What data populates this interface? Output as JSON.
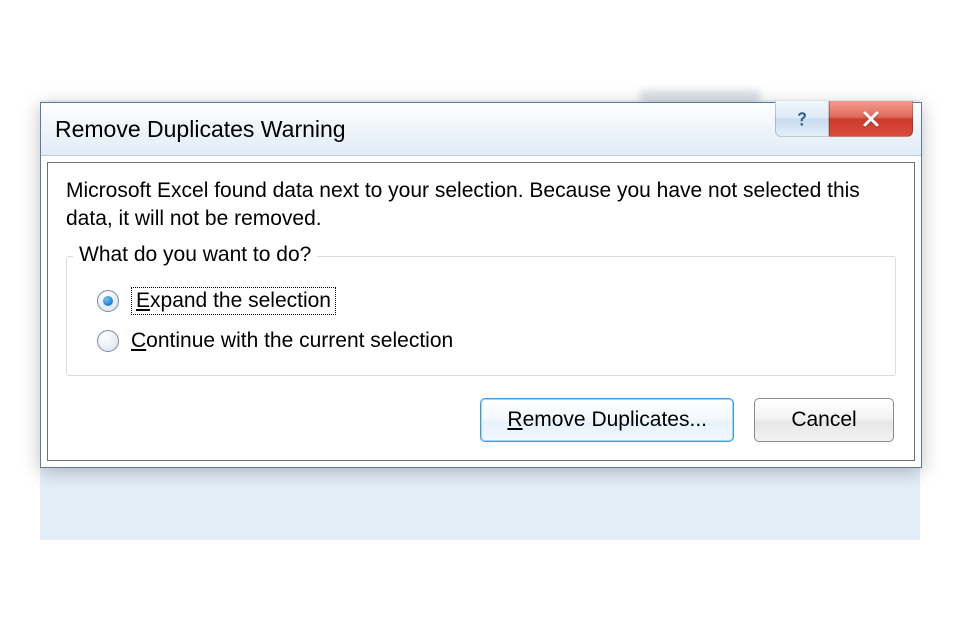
{
  "dialog": {
    "title": "Remove Duplicates Warning",
    "message": "Microsoft Excel found data next to your selection. Because you have not selected this data, it will not be removed.",
    "group_legend": "What do you want to do?",
    "options": {
      "expand": {
        "prefix": "",
        "accel": "E",
        "suffix": "xpand the selection",
        "checked": true
      },
      "continue": {
        "prefix": "",
        "accel": "C",
        "suffix": "ontinue with the current selection",
        "checked": false
      }
    },
    "buttons": {
      "primary": {
        "prefix": "",
        "accel": "R",
        "suffix": "emove Duplicates..."
      },
      "cancel": {
        "label": "Cancel"
      }
    }
  }
}
